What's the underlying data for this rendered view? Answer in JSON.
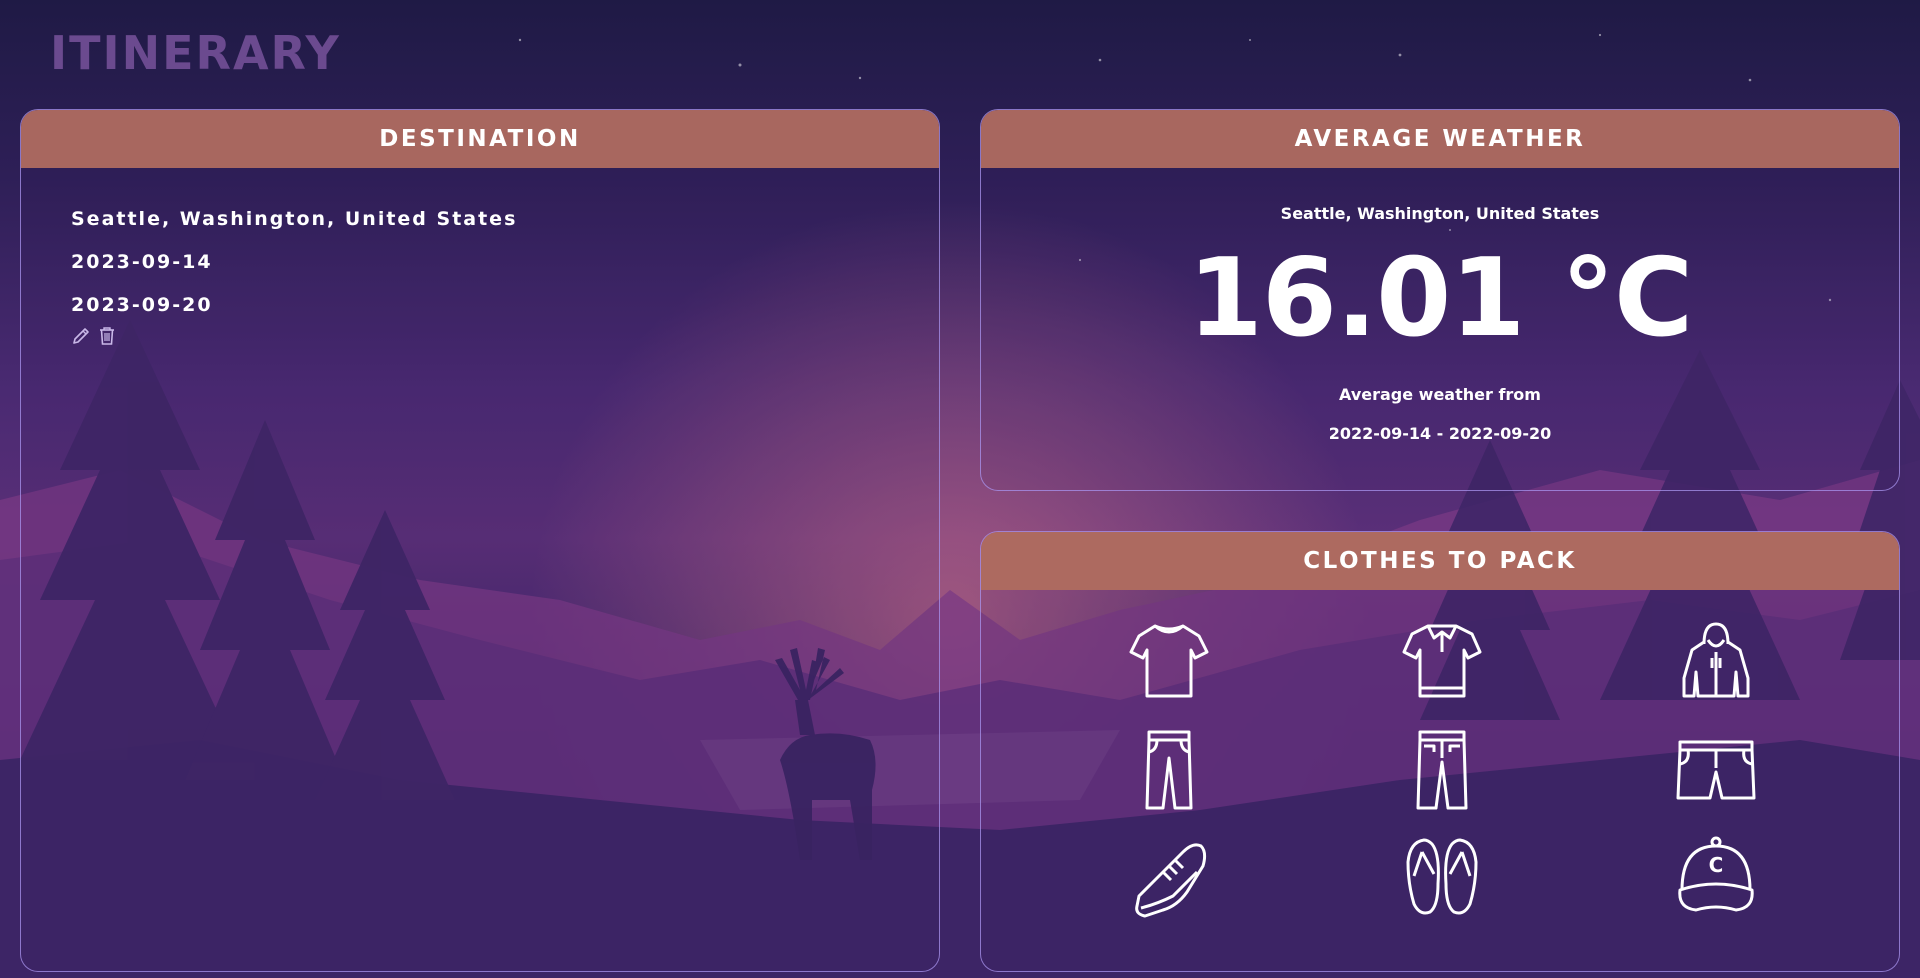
{
  "app": {
    "title": "ITINERARY"
  },
  "destination": {
    "header": "DESTINATION",
    "location": "Seattle, Washington, United States",
    "start_date": "2023-09-14",
    "end_date": "2023-09-20",
    "actions": [
      "edit-icon",
      "trash-icon"
    ]
  },
  "weather": {
    "header": "AVERAGE WEATHER",
    "location": "Seattle, Washington, United States",
    "temperature": "16.01 °C",
    "from_label": "Average weather from",
    "range": "2022-09-14 - 2022-09-20"
  },
  "clothes": {
    "header": "CLOTHES TO PACK",
    "items": [
      "t-shirt-icon",
      "polo-shirt-icon",
      "hoodie-icon",
      "pants-icon",
      "jeans-icon",
      "shorts-icon",
      "sneaker-icon",
      "flip-flops-icon",
      "cap-icon"
    ],
    "cap_letter": "C"
  },
  "colors": {
    "header_bg": "#a8675f",
    "card_border": "#aa96f0",
    "title_color": "#6b4a8f",
    "text": "#ffffff"
  }
}
